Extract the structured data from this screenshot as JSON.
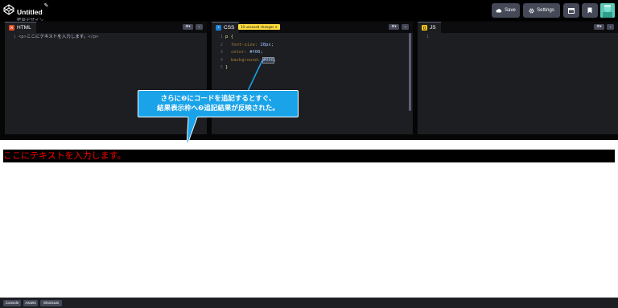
{
  "header": {
    "title": "Untitled",
    "subtitle": "藍奈デザイン",
    "save_label": "Save",
    "settings_label": "Settings",
    "icons": [
      "codepen-logo-icon",
      "pencil-icon",
      "cloud-icon",
      "gear-icon",
      "layout-icon",
      "bookmark-icon",
      "avatar"
    ]
  },
  "editors": {
    "html": {
      "label": "HTML",
      "lines": [
        {
          "n": "1",
          "open": "<p>",
          "text": "ここにテキストを入力します。",
          "close": "</p>"
        }
      ]
    },
    "css": {
      "label": "CSS",
      "badge": "10 unsaved changes ✕",
      "lines": [
        {
          "n": "1",
          "selector": "p {"
        },
        {
          "n": "2",
          "prop": "font-size:",
          "val": "20px",
          "end": ";"
        },
        {
          "n": "3",
          "prop": "color:",
          "val": "#f00",
          "end": ";"
        },
        {
          "n": "4",
          "prop": "background:",
          "val": "#000",
          "end": ";"
        },
        {
          "n": "5",
          "selector": "}"
        }
      ]
    },
    "js": {
      "label": "JS",
      "lines": [
        {
          "n": "1"
        }
      ]
    }
  },
  "callout": {
    "line1": "さらに❷にコードを追記するとすぐ、",
    "line2": "結果表示枠へ❷追記結果が反映された。"
  },
  "result": {
    "text": "ここにテキストを入力します。"
  },
  "footer": {
    "console_label": "Console",
    "assets_label": "Assets",
    "shortcuts_label": "Shortcuts"
  },
  "colors": {
    "accent_callout": "#1aa3e8",
    "result_text": "#ff0000",
    "result_bg": "#000000",
    "unsaved_badge": "#ffdd40"
  }
}
